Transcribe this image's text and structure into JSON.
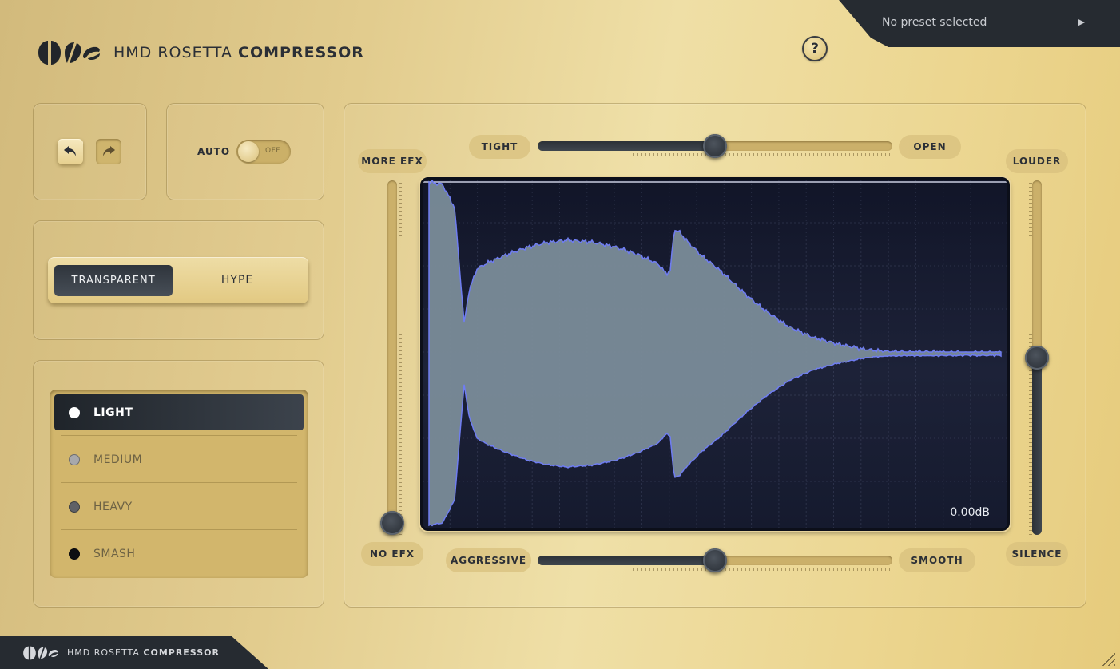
{
  "app": {
    "brand_prefix": "HMD ROSETTA",
    "brand_product": "COMPRESSOR",
    "help_label": "?"
  },
  "preset": {
    "current": "No preset selected",
    "next_icon": "play-arrow-icon"
  },
  "history": {
    "undo_icon": "undo-icon",
    "redo_icon": "redo-icon",
    "undo_enabled": true,
    "redo_enabled": false
  },
  "auto": {
    "label": "AUTO",
    "state": "OFF"
  },
  "mode": {
    "options": [
      "TRANSPARENT",
      "HYPE"
    ],
    "selected": "TRANSPARENT"
  },
  "levels": {
    "items": [
      {
        "label": "LIGHT",
        "dot_color": "#ffffff"
      },
      {
        "label": "MEDIUM",
        "dot_color": "#a7a8ac"
      },
      {
        "label": "HEAVY",
        "dot_color": "#5f6166"
      },
      {
        "label": "SMASH",
        "dot_color": "#0e0f12"
      }
    ],
    "selected": "LIGHT"
  },
  "controls": {
    "tight_label": "TIGHT",
    "open_label": "OPEN",
    "tight_open_value": 0.5,
    "aggressive_label": "AGGRESSIVE",
    "smooth_label": "SMOOTH",
    "aggressive_smooth_value": 0.5,
    "more_efx_label": "MORE EFX",
    "no_efx_label": "NO EFX",
    "efx_value": 0.0,
    "louder_label": "LOUDER",
    "silence_label": "SILENCE",
    "output_value": 0.5
  },
  "display": {
    "gain_readout": "0.00dB",
    "waveform_fill": "#7a8c99",
    "waveform_stroke": "#6f7df2"
  },
  "footer": {
    "brand_prefix": "HMD ROSETTA",
    "brand_product": "COMPRESSOR"
  }
}
